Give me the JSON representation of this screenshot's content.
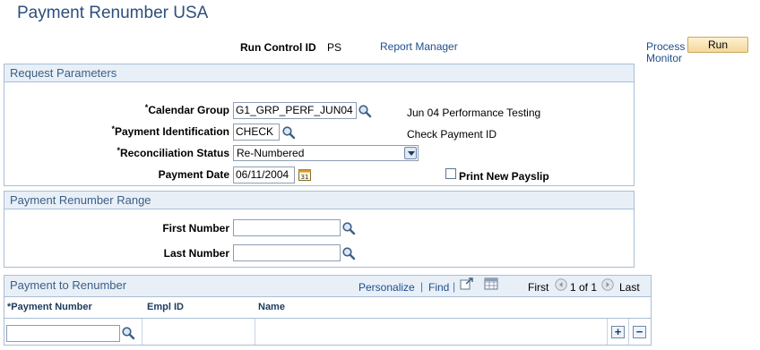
{
  "page": {
    "title": "Payment Renumber USA"
  },
  "run_control": {
    "label": "Run Control ID",
    "value": "PS",
    "report_manager": "Report Manager",
    "process_monitor": "Process Monitor",
    "process_monitor_line1": "Process",
    "process_monitor_line2": "Monitor",
    "run_button": "Run"
  },
  "request_parameters": {
    "title": "Request Parameters",
    "calendar_group": {
      "label": "Calendar Group",
      "value": "G1_GRP_PERF_JUN04",
      "description": "Jun 04 Performance Testing"
    },
    "payment_identification": {
      "label": "Payment Identification",
      "value": "CHECK",
      "description": "Check Payment ID"
    },
    "reconciliation_status": {
      "label": "Reconciliation Status",
      "value": "Re-Numbered"
    },
    "payment_date": {
      "label": "Payment Date",
      "value": "06/11/2004"
    },
    "print_new_payslip": {
      "label": "Print New Payslip",
      "checked": false
    }
  },
  "renumber_range": {
    "title": "Payment Renumber Range",
    "first_number": {
      "label": "First Number",
      "value": ""
    },
    "last_number": {
      "label": "Last Number",
      "value": ""
    }
  },
  "payment_grid": {
    "title": "Payment to Renumber",
    "personalize": "Personalize",
    "find": "Find",
    "separator": "|",
    "first": "First",
    "range": "1 of 1",
    "last": "Last",
    "columns": [
      "*Payment Number",
      "Empl ID",
      "Name"
    ],
    "rows": [
      {
        "payment_number": "",
        "empl_id": "",
        "name": ""
      }
    ]
  },
  "icons": {
    "lookup": "magnifier-icon",
    "calendar": "calendar-icon",
    "zoom": "view-all-icon",
    "download": "grid-download-icon",
    "prev": "previous-arrow-icon",
    "next": "next-arrow-icon",
    "add_row": "add-row-icon",
    "delete_row": "delete-row-icon"
  },
  "colors": {
    "title": "#2c4f7c",
    "link": "#1e4f8b",
    "group_header_bg": "#e8eff7",
    "group_border": "#a9bfd6",
    "run_button_bg": "#f4d79b"
  }
}
